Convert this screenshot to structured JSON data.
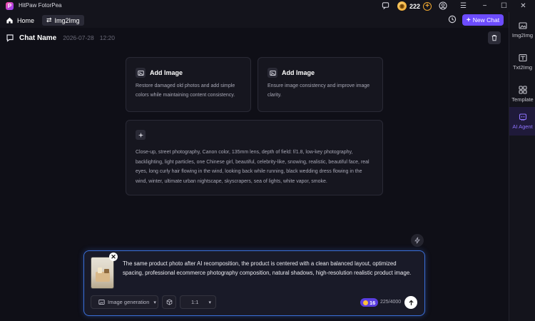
{
  "app": {
    "logo_letter": "P",
    "title": "HitPaw FotorPea"
  },
  "account": {
    "coins": "222",
    "add_symbol": "+"
  },
  "window_controls": {
    "minimize": "−",
    "maximize": "☐",
    "close": "✕",
    "menu": "☰"
  },
  "nav": {
    "home_label": "Home",
    "tab_label": "Img2Img",
    "new_chat_label": "New Chat"
  },
  "sidebar": {
    "items": [
      {
        "label": "Img2Img",
        "icon": "image-icon",
        "active": false
      },
      {
        "label": "Txt2Img",
        "icon": "text-image-icon",
        "active": false
      },
      {
        "label": "Template",
        "icon": "template-icon",
        "active": false
      },
      {
        "label": "AI Agent",
        "icon": "ai-agent-icon",
        "active": true
      }
    ]
  },
  "chat": {
    "title": "Chat Name",
    "date": "2026-07-28",
    "time": "12:20"
  },
  "cards": [
    {
      "title": "Add Image",
      "description": "Restore damaged old photos and add simple colors while maintaining content consistency."
    },
    {
      "title": "Add Image",
      "description": "Ensure image consistency and improve image clarity."
    }
  ],
  "prompt_card": {
    "text": "Close-up, street photography, Canon color, 135mm lens, depth of field: f/1.8, low-key photography, backlighting, light particles, one Chinese girl, beautiful, celebrity-like, snowing, realistic, beautiful face, real eyes, long curly hair flowing in the wind, looking back while running, black wedding dress flowing in the wind, winter, ultimate urban nightscape, skyscrapers, sea of lights, white vapor, smoke."
  },
  "composer": {
    "text": "The same product photo after AI recomposition, the product is centered with a clean balanced layout, optimized spacing, professional ecommerce photography composition, natural shadows, high-resolution realistic product image.",
    "mode": "Image generation",
    "ratio": "1:1",
    "credits": "16",
    "char_count": "225/4000"
  },
  "colors": {
    "accent": "#6c4cff",
    "focus_border": "#3a6fd8",
    "coin": "#f0a830"
  }
}
